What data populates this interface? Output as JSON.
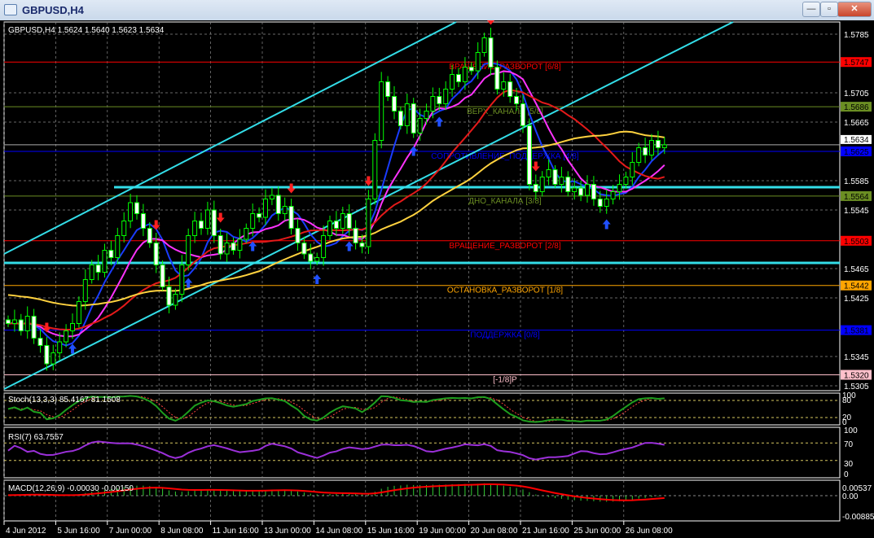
{
  "window": {
    "title": "GBPUSD,H4",
    "minimize": "—",
    "maximize": "▫",
    "close": "✕"
  },
  "chart": {
    "info": "GBPUSD,H4  1.5624 1.5640 1.5623 1.5634",
    "current_price": "1.5634",
    "price_ticks": [
      "1.5785",
      "1.5705",
      "1.5665",
      "1.5585",
      "1.5545",
      "1.5465",
      "1.5425",
      "1.5345",
      "1.5305"
    ],
    "levels": [
      {
        "price": "1.5747",
        "label": "ВРАЩЕНИЕ_РАЗВОРОТ [6/8]",
        "color": "#ff0000"
      },
      {
        "price": "1.5686",
        "label": "ВЕРХ_КАНАЛА [5/8]",
        "color": "#6b8e23"
      },
      {
        "price": "1.5625",
        "label": "СОПРОТИВЛЕНИЕ_ПОДДЕРЖКА [4/8]",
        "color": "#0000ff"
      },
      {
        "price": "1.5564",
        "label": "ДНО_КАНАЛА [3/8]",
        "color": "#6b8e23"
      },
      {
        "price": "1.5503",
        "label": "ВРАЩЕНИЕ_РАЗВОРОТ [2/8]",
        "color": "#ff0000"
      },
      {
        "price": "1.5442",
        "label": "ОСТАНОВКА_РАЗВОРОТ [1/8]",
        "color": "#ffa500"
      },
      {
        "price": "1.5381",
        "label": "ПОДДЕРЖКА [0/8]",
        "color": "#0000ff"
      },
      {
        "price": "1.5320",
        "label": "[-1/8]P",
        "color": "#ffc0cb"
      }
    ],
    "time_labels": [
      "4 Jun 2012",
      "5 Jun 16:00",
      "7 Jun 00:00",
      "8 Jun 08:00",
      "11 Jun 16:00",
      "13 Jun 00:00",
      "14 Jun 08:00",
      "15 Jun 16:00",
      "19 Jun 00:00",
      "20 Jun 08:00",
      "21 Jun 16:00",
      "25 Jun 00:00",
      "26 Jun 08:00"
    ],
    "closes": [
      1.539,
      1.5395,
      1.538,
      1.54,
      1.537,
      1.536,
      1.5335,
      1.535,
      1.5365,
      1.538,
      1.539,
      1.542,
      1.545,
      1.547,
      1.546,
      1.549,
      1.548,
      1.551,
      1.553,
      1.5555,
      1.554,
      1.552,
      1.55,
      1.547,
      1.544,
      1.5415,
      1.543,
      1.547,
      1.551,
      1.553,
      1.552,
      1.5545,
      1.551,
      1.5485,
      1.55,
      1.549,
      1.5505,
      1.552,
      1.554,
      1.5535,
      1.556,
      1.5565,
      1.554,
      1.555,
      1.552,
      1.55,
      1.5485,
      1.5475,
      1.548,
      1.551,
      1.553,
      1.552,
      1.554,
      1.552,
      1.55,
      1.5495,
      1.556,
      1.564,
      1.572,
      1.57,
      1.568,
      1.566,
      1.569,
      1.565,
      1.567,
      1.568,
      1.57,
      1.569,
      1.571,
      1.573,
      1.572,
      1.574,
      1.5735,
      1.576,
      1.578,
      1.574,
      1.571,
      1.572,
      1.57,
      1.569,
      1.566,
      1.558,
      1.557,
      1.559,
      1.56,
      1.558,
      1.559,
      1.557,
      1.5575,
      1.5565,
      1.558,
      1.556,
      1.555,
      1.556,
      1.557,
      1.558,
      1.559,
      1.561,
      1.563,
      1.562,
      1.564,
      1.563,
      1.5634
    ],
    "arrows_down": [
      6,
      23,
      33,
      44,
      56,
      75,
      82
    ],
    "arrows_up": [
      10,
      28,
      38,
      48,
      53,
      63,
      67,
      93
    ]
  },
  "stoch": {
    "label": "Stoch(13,3,3) 85.4167 81.1508",
    "ticks": [
      "100",
      "80",
      "20",
      "0"
    ]
  },
  "rsi": {
    "label": "RSI(7) 63.7557",
    "ticks": [
      "100",
      "70",
      "30",
      "0"
    ]
  },
  "macd": {
    "label": "MACD(12,26,9) -0.00030 -0.00150",
    "ticks": [
      "0.00537",
      "0.00",
      "-0.00885"
    ]
  },
  "colors": {
    "bg": "#000000",
    "grid": "#8a8a8a",
    "candle": "#00ff00",
    "ma_fast": "#1a3cff",
    "ma_mid": "#ff33ff",
    "ma_slow": "#e41a1a",
    "ma_long": "#ffd23f",
    "channel": "#33dde8",
    "stoch_main": "#1e9e1e",
    "stoch_signal": "#ff4040",
    "rsi": "#9b30d9",
    "macd_hist": "#33cc33",
    "macd_signal": "#ff0000"
  }
}
